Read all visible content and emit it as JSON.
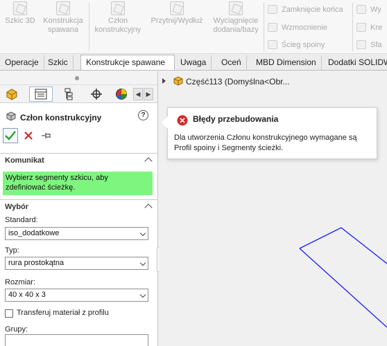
{
  "ribbon": {
    "buttons": [
      {
        "label": "Szkic 3D",
        "icon": "sketch-3d-icon"
      },
      {
        "label": "Konstrukcja spawana",
        "icon": "weldment-icon"
      },
      {
        "label": "Człon konstrukcyjny",
        "icon": "structural-member-icon"
      },
      {
        "label": "Przytnij/Wydłuż",
        "icon": "trim-extend-icon"
      },
      {
        "label": "Wyciągnięcie dodania/bazy",
        "icon": "extruded-boss-icon"
      }
    ],
    "small_items": [
      {
        "label": "Zamknięcie końca",
        "icon": "end-cap-icon"
      },
      {
        "label": "Wzmocnienie",
        "icon": "gusset-icon"
      },
      {
        "label": "Ścieg spoiny",
        "icon": "weld-bead-icon"
      }
    ],
    "cut_items": [
      "Wy",
      "Kre",
      "Sfa"
    ]
  },
  "tabs": [
    {
      "label": "Operacje",
      "active": false
    },
    {
      "label": "Szkic",
      "active": false
    },
    {
      "label": "Konstrukcje spawane",
      "active": true
    },
    {
      "label": "Uwaga",
      "active": false
    },
    {
      "label": "Oceń",
      "active": false
    },
    {
      "label": "MBD Dimension",
      "active": false
    },
    {
      "label": "Dodatki SOLIDWORKS",
      "active": false
    }
  ],
  "manager_tabs": [
    {
      "icon": "featuremanager-icon"
    },
    {
      "icon": "propertymanager-icon"
    },
    {
      "icon": "configurationmanager-icon"
    },
    {
      "icon": "dimxpert-icon"
    },
    {
      "icon": "display-manager-icon"
    }
  ],
  "property_manager": {
    "title": "Człon konstrukcyjny",
    "help": "?",
    "message_section": {
      "title": "Komunikat",
      "text": "Wybierz segmenty szkicu, aby zdefiniować ścieżkę."
    },
    "selection_section": {
      "title": "Wybór",
      "standard_label": "Standard:",
      "standard_value": "iso_dodatkowe",
      "type_label": "Typ:",
      "type_value": "rura prostokątna",
      "size_label": "Rozmiar:",
      "size_value": "40 x 40 x 3",
      "transfer_label": "Transferuj materiał z profilu",
      "transfer_checked": false,
      "groups_label": "Grupy:"
    }
  },
  "viewport": {
    "tree_label": "Część113  (Domyślna<Obr...",
    "error_tooltip": {
      "title": "Błędy przebudowania",
      "body": "Dla utworzenia Członu konstrukcyjnego wymagane są Profil spoiny i Segmenty ścieżki."
    },
    "sketch_line_color": "#1a1aff"
  },
  "colors": {
    "message_bg": "#7ef57e",
    "ok_green": "#2e9e2e",
    "cancel_red": "#d62020",
    "error_red": "#d42a2a"
  }
}
